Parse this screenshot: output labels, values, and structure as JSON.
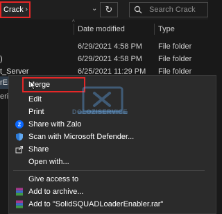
{
  "address": {
    "crumb": "Crack",
    "crumb_sep": "›",
    "search_placeholder": "Search Crack"
  },
  "columns": {
    "date": "Date modified",
    "type": "Type"
  },
  "files": [
    {
      "name": "",
      "date": "6/29/2021 4:58 PM",
      "type": "File folder"
    },
    {
      "name": ")",
      "date": "6/29/2021 4:58 PM",
      "type": "File folder"
    },
    {
      "name": "t_Server",
      "date": "6/25/2021 11:29 PM",
      "type": "File folder"
    }
  ],
  "behind": {
    "selected_name": "rEn",
    "next_name": "eria"
  },
  "menu": {
    "items": [
      {
        "label": "Merge"
      },
      {
        "label": "Edit"
      },
      {
        "label": "Print"
      },
      {
        "label": "Share with Zalo"
      },
      {
        "label": "Scan with Microsoft Defender..."
      },
      {
        "label": "Share"
      },
      {
        "label": "Open with..."
      },
      {
        "label": "Give access to"
      },
      {
        "label": "Add to archive..."
      },
      {
        "label": "Add to \"SolidSQUADLoaderEnabler.rar\""
      }
    ]
  },
  "watermark": {
    "text": "DOLOZISERVICE"
  },
  "colors": {
    "highlight": "#e52727",
    "accent": "#3a7bd5"
  }
}
